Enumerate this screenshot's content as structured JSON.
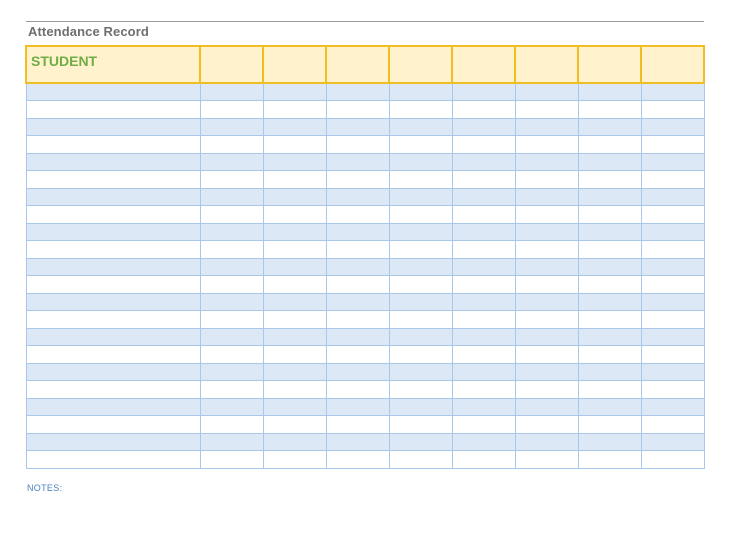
{
  "document": {
    "title": "Attendance Record",
    "notes_label": "NOTES:"
  },
  "table": {
    "header": {
      "first_column": "STUDENT",
      "date_columns": [
        "",
        "",
        "",
        "",
        "",
        "",
        "",
        ""
      ]
    },
    "rows": [
      {
        "student": "",
        "shaded": true,
        "marks": [
          "",
          "",
          "",
          "",
          "",
          "",
          "",
          ""
        ]
      },
      {
        "student": "",
        "shaded": false,
        "marks": [
          "",
          "",
          "",
          "",
          "",
          "",
          "",
          ""
        ]
      },
      {
        "student": "",
        "shaded": true,
        "marks": [
          "",
          "",
          "",
          "",
          "",
          "",
          "",
          ""
        ]
      },
      {
        "student": "",
        "shaded": false,
        "marks": [
          "",
          "",
          "",
          "",
          "",
          "",
          "",
          ""
        ]
      },
      {
        "student": "",
        "shaded": true,
        "marks": [
          "",
          "",
          "",
          "",
          "",
          "",
          "",
          ""
        ]
      },
      {
        "student": "",
        "shaded": false,
        "marks": [
          "",
          "",
          "",
          "",
          "",
          "",
          "",
          ""
        ]
      },
      {
        "student": "",
        "shaded": true,
        "marks": [
          "",
          "",
          "",
          "",
          "",
          "",
          "",
          ""
        ]
      },
      {
        "student": "",
        "shaded": false,
        "marks": [
          "",
          "",
          "",
          "",
          "",
          "",
          "",
          ""
        ]
      },
      {
        "student": "",
        "shaded": true,
        "marks": [
          "",
          "",
          "",
          "",
          "",
          "",
          "",
          ""
        ]
      },
      {
        "student": "",
        "shaded": false,
        "marks": [
          "",
          "",
          "",
          "",
          "",
          "",
          "",
          ""
        ]
      },
      {
        "student": "",
        "shaded": true,
        "marks": [
          "",
          "",
          "",
          "",
          "",
          "",
          "",
          ""
        ]
      },
      {
        "student": "",
        "shaded": false,
        "marks": [
          "",
          "",
          "",
          "",
          "",
          "",
          "",
          ""
        ]
      },
      {
        "student": "",
        "shaded": true,
        "marks": [
          "",
          "",
          "",
          "",
          "",
          "",
          "",
          ""
        ]
      },
      {
        "student": "",
        "shaded": false,
        "marks": [
          "",
          "",
          "",
          "",
          "",
          "",
          "",
          ""
        ]
      },
      {
        "student": "",
        "shaded": true,
        "marks": [
          "",
          "",
          "",
          "",
          "",
          "",
          "",
          ""
        ]
      },
      {
        "student": "",
        "shaded": false,
        "marks": [
          "",
          "",
          "",
          "",
          "",
          "",
          "",
          ""
        ]
      },
      {
        "student": "",
        "shaded": true,
        "marks": [
          "",
          "",
          "",
          "",
          "",
          "",
          "",
          ""
        ]
      },
      {
        "student": "",
        "shaded": false,
        "marks": [
          "",
          "",
          "",
          "",
          "",
          "",
          "",
          ""
        ]
      },
      {
        "student": "",
        "shaded": true,
        "marks": [
          "",
          "",
          "",
          "",
          "",
          "",
          "",
          ""
        ]
      },
      {
        "student": "",
        "shaded": false,
        "marks": [
          "",
          "",
          "",
          "",
          "",
          "",
          "",
          ""
        ]
      },
      {
        "student": "",
        "shaded": true,
        "marks": [
          "",
          "",
          "",
          "",
          "",
          "",
          "",
          ""
        ]
      },
      {
        "student": "",
        "shaded": false,
        "marks": [
          "",
          "",
          "",
          "",
          "",
          "",
          "",
          ""
        ]
      }
    ]
  },
  "colors": {
    "title_text": "#6f6f6f",
    "header_fill": "#fff2cc",
    "header_border": "#f0bd22",
    "student_header_text": "#70ad47",
    "row_shade": "#dde8f6",
    "grid_line": "#a9c7e8",
    "notes_text": "#4a7fc1"
  }
}
